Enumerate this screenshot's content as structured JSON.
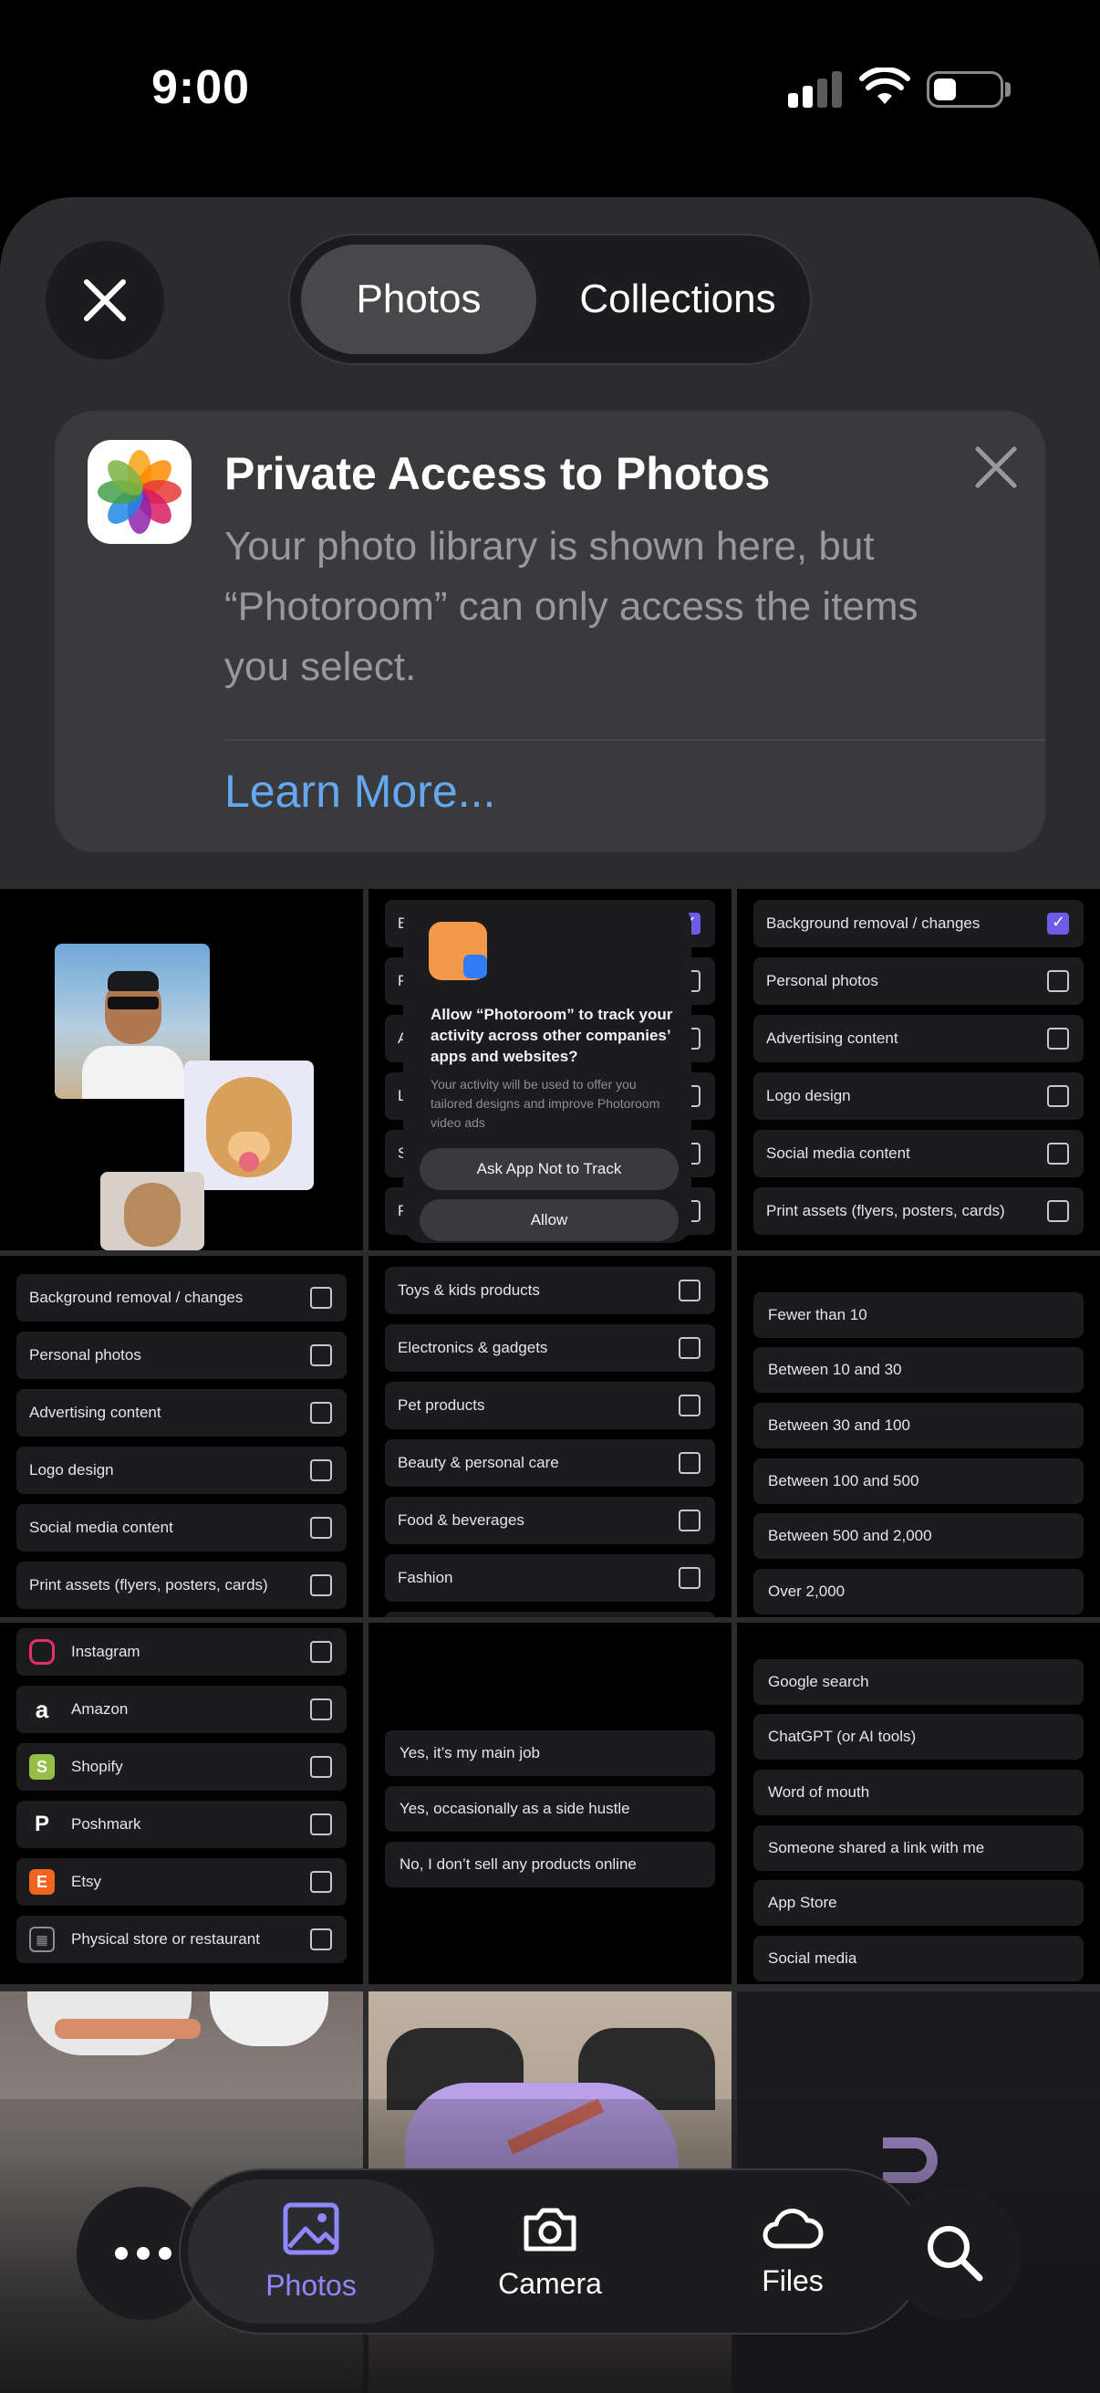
{
  "status_bar": {
    "time": "9:00"
  },
  "header": {
    "segments": [
      "Photos",
      "Collections"
    ],
    "active_segment": "Photos"
  },
  "banner": {
    "title": "Private Access to Photos",
    "text": "Your photo library is shown here, but “Photoroom” can only access the items you select.",
    "link": "Learn More..."
  },
  "att_dialog": {
    "title": "Allow “Photoroom” to track your activity across other companies’ apps and websites?",
    "text": "Your activity will be used to offer you tailored designs and improve Photoroom video ads",
    "ask_not_to_track": "Ask App Not to Track",
    "allow": "Allow",
    "background_prefixes": [
      "B",
      "P",
      "A",
      "L",
      "S",
      "P"
    ]
  },
  "use_cases": [
    {
      "label": "Background removal / changes",
      "checked": true
    },
    {
      "label": "Personal photos",
      "checked": false
    },
    {
      "label": "Advertising content",
      "checked": false
    },
    {
      "label": "Logo design",
      "checked": false
    },
    {
      "label": "Social media content",
      "checked": false
    },
    {
      "label": "Print assets (flyers, posters, cards)",
      "checked": false
    }
  ],
  "use_cases_b": [
    {
      "label": "Background removal / changes",
      "checked": false
    },
    {
      "label": "Personal photos",
      "checked": false
    },
    {
      "label": "Advertising content",
      "checked": false
    },
    {
      "label": "Logo design",
      "checked": false
    },
    {
      "label": "Social media content",
      "checked": false
    },
    {
      "label": "Print assets (flyers, posters, cards)",
      "checked": false
    }
  ],
  "categories": [
    "Toys & kids products",
    "Electronics & gadgets",
    "Pet products",
    "Beauty & personal care",
    "Food & beverages",
    "Fashion"
  ],
  "volumes": [
    "Fewer than 10",
    "Between 10 and 30",
    "Between 30 and 100",
    "Between 100 and 500",
    "Between 500 and 2,000",
    "Over 2,000"
  ],
  "platforms": [
    {
      "label": "Instagram",
      "icon": "instagram-icon",
      "color": "#e1306c"
    },
    {
      "label": "Amazon",
      "icon": "amazon-icon",
      "color": "#ffffff"
    },
    {
      "label": "Shopify",
      "icon": "shopify-icon",
      "color": "#95bf47"
    },
    {
      "label": "Poshmark",
      "icon": "poshmark-icon",
      "color": "#ffffff"
    },
    {
      "label": "Etsy",
      "icon": "etsy-icon",
      "color": "#f1641e"
    },
    {
      "label": "Physical store or restaurant",
      "icon": "store-icon",
      "color": "#8e8e93"
    }
  ],
  "sell_online": [
    "Yes, it’s my main job",
    "Yes, occasionally as a side hustle",
    "No, I don’t sell any products online"
  ],
  "sources": [
    "Google search",
    "ChatGPT (or AI tools)",
    "Word of mouth",
    "Someone shared a link with me",
    "App Store",
    "Social media"
  ],
  "tabbar": {
    "more_icon": "ellipsis-icon",
    "tabs": [
      {
        "label": "Photos",
        "icon": "photo-icon"
      },
      {
        "label": "Camera",
        "icon": "camera-icon"
      },
      {
        "label": "Files",
        "icon": "cloud-icon"
      }
    ],
    "search_icon": "search-icon",
    "accent": "#8e87ff"
  }
}
